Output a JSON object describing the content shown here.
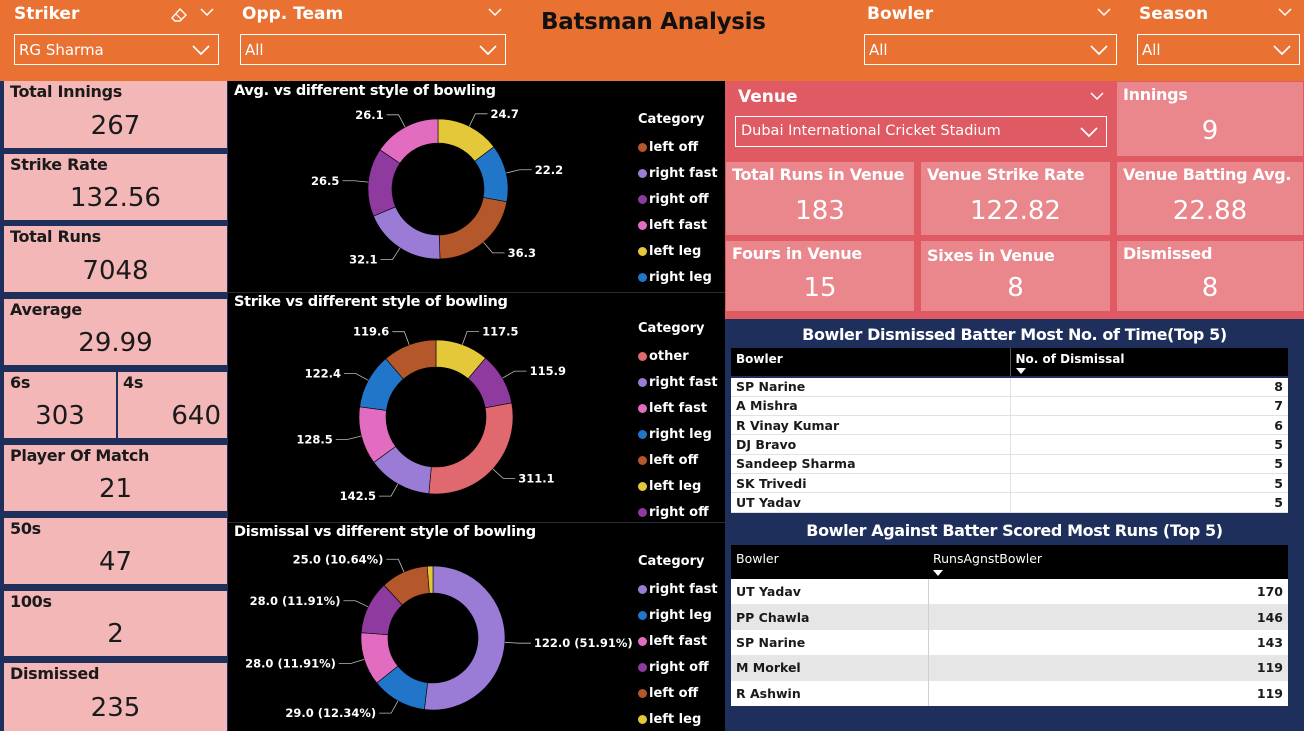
{
  "header": {
    "title": "Batsman Analysis",
    "slicers": {
      "striker": {
        "label": "Striker",
        "value": "RG Sharma"
      },
      "opp_team": {
        "label": "Opp. Team",
        "value": "All"
      },
      "bowler": {
        "label": "Bowler",
        "value": "All"
      },
      "season": {
        "label": "Season",
        "value": "All"
      }
    }
  },
  "kpis": {
    "total_innings": {
      "label": "Total Innings",
      "value": "267"
    },
    "strike_rate": {
      "label": "Strike Rate",
      "value": "132.56"
    },
    "total_runs": {
      "label": "Total Runs",
      "value": "7048"
    },
    "average": {
      "label": "Average",
      "value": "29.99"
    },
    "sixes": {
      "label": "6s",
      "value": "303"
    },
    "fours": {
      "label": "4s",
      "value": "640"
    },
    "player_of_match": {
      "label": "Player Of Match",
      "value": "21"
    },
    "fifties": {
      "label": "50s",
      "value": "47"
    },
    "hundreds": {
      "label": "100s",
      "value": "2"
    },
    "dismissed": {
      "label": "Dismissed",
      "value": "235"
    }
  },
  "venue": {
    "label": "Venue",
    "value": "Dubai International Cricket Stadium",
    "innings": {
      "label": "Innings",
      "value": "9"
    },
    "total_runs": {
      "label": "Total Runs in Venue",
      "value": "183"
    },
    "strike_rate": {
      "label": "Venue Strike Rate",
      "value": "122.82"
    },
    "batting_avg": {
      "label": "Venue Batting Avg.",
      "value": "22.88"
    },
    "fours": {
      "label": "Fours in Venue",
      "value": "15"
    },
    "sixes": {
      "label": "Sixes in Venue",
      "value": "8"
    },
    "dismissed": {
      "label": "Dismissed",
      "value": "8"
    }
  },
  "colors": {
    "header_orange": "#E97132",
    "navy": "#1F2F5C",
    "kpi_pink": "#F4B7B8",
    "venue_red": "#E05A63",
    "venue_box": "#E9878C",
    "left_off": "#B4572A",
    "right_fast": "#9A7BD6",
    "right_off": "#8E3A9E",
    "left_fast": "#E26CC0",
    "left_leg": "#E5C83A",
    "right_leg": "#2176C9",
    "other": "#E0686F"
  },
  "chart_data": [
    {
      "type": "pie",
      "title": "Avg. vs different style of bowling",
      "legend_title": "Category",
      "legend_position": "right",
      "categories": [
        "left off",
        "right fast",
        "right off",
        "left fast",
        "left leg",
        "right leg"
      ],
      "legend": [
        "left off",
        "right fast",
        "right off",
        "left fast",
        "left leg",
        "right leg"
      ],
      "slice_order": [
        "left leg",
        "right leg",
        "left off",
        "right fast",
        "right off",
        "left fast"
      ],
      "slice_values": [
        24.7,
        22.2,
        36.3,
        32.1,
        26.5,
        26.1
      ],
      "slice_labels": [
        "24.7",
        "22.2",
        "36.3",
        "32.1",
        "26.5",
        "26.1"
      ],
      "slice_colors": [
        "#E5C83A",
        "#2176C9",
        "#B4572A",
        "#9A7BD6",
        "#8E3A9E",
        "#E26CC0"
      ]
    },
    {
      "type": "pie",
      "title": "Strike vs different style of bowling",
      "legend_title": "Category",
      "legend_position": "right",
      "legend": [
        "other",
        "right fast",
        "left fast",
        "right leg",
        "left off",
        "left leg",
        "right off"
      ],
      "slice_order": [
        "left leg",
        "right off",
        "other",
        "right fast",
        "left fast",
        "right leg",
        "left off"
      ],
      "slice_values": [
        117.5,
        115.9,
        311.1,
        142.5,
        128.5,
        122.4,
        119.6
      ],
      "slice_labels": [
        "117.5",
        "115.9",
        "311.1",
        "142.5",
        "128.5",
        "122.4",
        "119.6"
      ],
      "slice_colors": [
        "#E5C83A",
        "#8E3A9E",
        "#E0686F",
        "#9A7BD6",
        "#E26CC0",
        "#2176C9",
        "#B4572A"
      ]
    },
    {
      "type": "pie",
      "title": "Dismissal vs different style of bowling",
      "legend_title": "Category",
      "legend_position": "right",
      "legend": [
        "right fast",
        "right leg",
        "left fast",
        "right off",
        "left off",
        "left leg"
      ],
      "slice_order": [
        "right fast",
        "right leg",
        "left fast",
        "right off",
        "left off",
        "left leg"
      ],
      "slice_values": [
        122.0,
        29.0,
        28.0,
        28.0,
        25.0,
        3.0
      ],
      "slice_labels": [
        "122.0 (51.91%)",
        "29.0 (12.34%)",
        "28.0 (11.91%)",
        "28.0 (11.91%)",
        "25.0 (10.64%)",
        ""
      ],
      "slice_colors": [
        "#9A7BD6",
        "#2176C9",
        "#E26CC0",
        "#8E3A9E",
        "#B4572A",
        "#E5C83A"
      ]
    }
  ],
  "dismissal_table": {
    "title": "Bowler Dismissed Batter Most No. of Time(Top 5)",
    "columns": [
      "Bowler",
      "No. of Dismissal"
    ],
    "rows": [
      [
        "SP Narine",
        "8"
      ],
      [
        "A Mishra",
        "7"
      ],
      [
        "R Vinay Kumar",
        "6"
      ],
      [
        "DJ Bravo",
        "5"
      ],
      [
        "Sandeep Sharma",
        "5"
      ],
      [
        "SK Trivedi",
        "5"
      ],
      [
        "UT Yadav",
        "5"
      ]
    ]
  },
  "runs_table": {
    "title": "Bowler Against Batter Scored Most Runs (Top 5)",
    "columns": [
      "Bowler",
      "RunsAgnstBowler"
    ],
    "rows": [
      [
        "UT Yadav",
        "170"
      ],
      [
        "PP Chawla",
        "146"
      ],
      [
        "SP Narine",
        "143"
      ],
      [
        "M Morkel",
        "119"
      ],
      [
        "R Ashwin",
        "119"
      ]
    ]
  }
}
